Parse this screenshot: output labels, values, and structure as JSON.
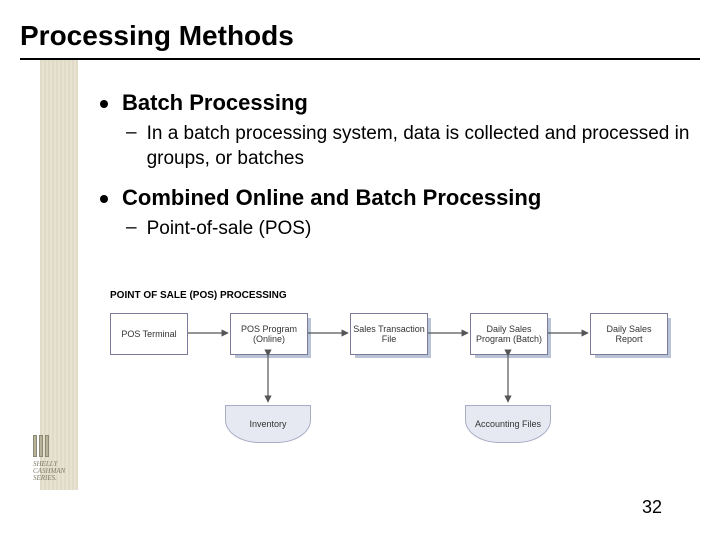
{
  "title": "Processing Methods",
  "bullets": [
    {
      "heading": "Batch Processing",
      "sub": "In a batch processing system, data is collected and processed in groups, or batches"
    },
    {
      "heading": "Combined Online and Batch Processing",
      "sub": "Point-of-sale (POS)"
    }
  ],
  "diagram": {
    "title": "POINT OF SALE (POS) PROCESSING",
    "boxes": {
      "pos_terminal": "POS Terminal",
      "pos_program": "POS Program (Online)",
      "sales_file": "Sales Transaction File",
      "daily_program": "Daily Sales Program (Batch)",
      "daily_report": "Daily Sales Report",
      "inventory": "Inventory",
      "accounting": "Accounting Files"
    }
  },
  "page_number": "32",
  "logo": {
    "line1": "SHELLY",
    "line2": "CASHMAN",
    "line3": "SERIES."
  }
}
